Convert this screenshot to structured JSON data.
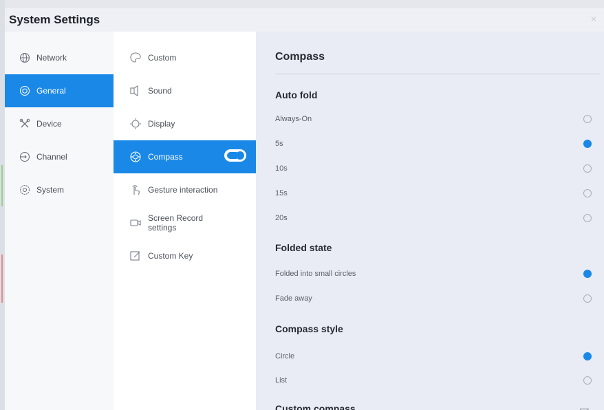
{
  "window": {
    "title": "System Settings"
  },
  "nav": {
    "items": [
      {
        "label": "Network",
        "icon": "globe-icon",
        "active": false
      },
      {
        "label": "General",
        "icon": "cube-icon",
        "active": true
      },
      {
        "label": "Device",
        "icon": "tools-icon",
        "active": false
      },
      {
        "label": "Channel",
        "icon": "input-icon",
        "active": false
      },
      {
        "label": "System",
        "icon": "gear-icon",
        "active": false
      }
    ]
  },
  "submenu": {
    "items": [
      {
        "label": "Custom",
        "icon": "palette-icon",
        "active": false
      },
      {
        "label": "Sound",
        "icon": "speaker-icon",
        "active": false
      },
      {
        "label": "Display",
        "icon": "sun-icon",
        "active": false
      },
      {
        "label": "Compass",
        "icon": "compass-icon",
        "active": true,
        "toggle": true,
        "toggle_on": true
      },
      {
        "label": "Gesture interaction",
        "icon": "hand-icon",
        "active": false
      },
      {
        "label": "Screen Record settings",
        "line1": "Screen Record",
        "line2": "settings",
        "icon": "camera-icon",
        "active": false
      },
      {
        "label": "Custom Key",
        "icon": "edit-icon",
        "active": false
      }
    ]
  },
  "panel": {
    "title": "Compass",
    "sections": [
      {
        "heading": "Auto fold",
        "options": [
          {
            "label": "Always-On",
            "selected": false
          },
          {
            "label": "5s",
            "selected": true
          },
          {
            "label": "10s",
            "selected": false
          },
          {
            "label": "15s",
            "selected": false
          },
          {
            "label": "20s",
            "selected": false
          }
        ]
      },
      {
        "heading": "Folded state",
        "options": [
          {
            "label": "Folded into small circles",
            "selected": true
          },
          {
            "label": "Fade away",
            "selected": false
          }
        ]
      },
      {
        "heading": "Compass style",
        "options": [
          {
            "label": "Circle",
            "selected": true
          },
          {
            "label": "List",
            "selected": false
          }
        ]
      },
      {
        "heading": "Custom compass",
        "options": []
      }
    ]
  },
  "colors": {
    "accent": "#1a88e6",
    "panel_bg": "#e9ebf5",
    "sidebar_bg": "#f7f8fa"
  }
}
